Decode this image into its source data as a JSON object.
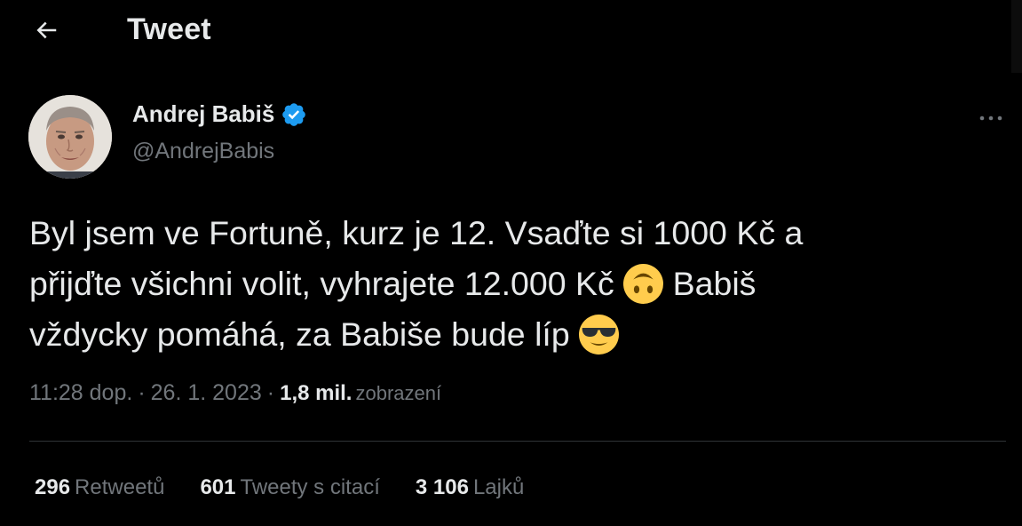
{
  "header": {
    "title": "Tweet",
    "back_icon": "arrow-left-icon"
  },
  "author": {
    "name": "Andrej Babiš",
    "handle": "@AndrejBabis",
    "verified_color": "#1d9bf0"
  },
  "tweet": {
    "lines": [
      "Byl jsem ve Fortuně, kurz je 12. Vsaďte si 1000 Kč a",
      "přijďte všichni volit, vyhrajete 12.000 Kč",
      "Babiš",
      "vždycky pomáhá, za Babiše bude líp"
    ],
    "emojis": [
      "upside-down-face",
      "smiling-face-with-sunglasses"
    ]
  },
  "meta": {
    "time": "11:28 dop.",
    "separator": "·",
    "date": "26. 1. 2023",
    "views_count": "1,8 mil.",
    "views_label": "zobrazení"
  },
  "stats": [
    {
      "count": "296",
      "label": "Retweetů"
    },
    {
      "count": "601",
      "label": "Tweety s citací"
    },
    {
      "count": "3 106",
      "label": "Lajků"
    }
  ],
  "colors": {
    "background": "#000000",
    "text": "#e7e9ea",
    "secondary_text": "#71767b",
    "divider": "#2f3336",
    "emoji_yellow": "#ffcc4d"
  }
}
